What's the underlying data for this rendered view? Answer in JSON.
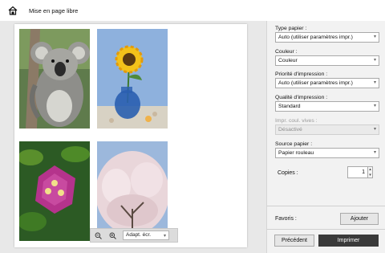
{
  "window": {
    "title": "Mise en page libre"
  },
  "settings": {
    "paper_type": {
      "label": "Type papier :",
      "value": "Auto (utiliser paramètres impr.)"
    },
    "color": {
      "label": "Couleur :",
      "value": "Couleur"
    },
    "print_priority": {
      "label": "Priorité d'impression :",
      "value": "Auto (utiliser paramètres impr.)"
    },
    "print_quality": {
      "label": "Qualité d'impression :",
      "value": "Standard"
    },
    "vivid": {
      "label": "Impr. coul. vives :",
      "value": "Désactivé"
    },
    "paper_source": {
      "label": "Source papier :",
      "value": "Papier rouleau"
    },
    "copies": {
      "label": "Copies :",
      "value": "1"
    }
  },
  "favorites": {
    "label": "Favoris :",
    "add_button": "Ajouter"
  },
  "footer": {
    "previous_button": "Précédent",
    "print_button": "Imprimer"
  },
  "preview": {
    "zoom_select": "Adapt. écr.",
    "photos": [
      "koala",
      "sunflower",
      "bougainvillea",
      "cherry-blossom"
    ]
  },
  "icons": {
    "home": "printer-home-icon",
    "zoom_out": "zoom-out-icon",
    "zoom_in": "zoom-in-icon",
    "dropdown": "chevron-down-icon"
  }
}
